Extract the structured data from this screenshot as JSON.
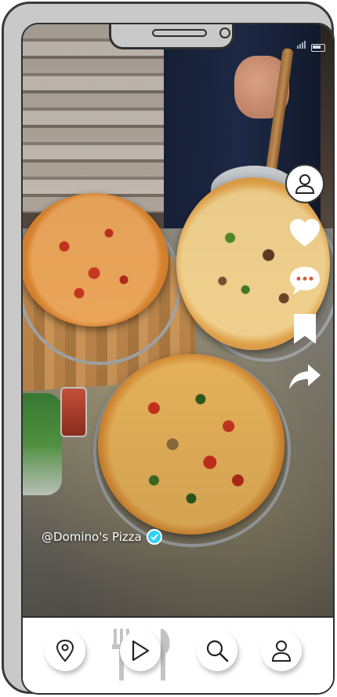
{
  "post": {
    "handle": "@Domino's Pizza",
    "verified": true
  },
  "actions": [
    {
      "name": "profile",
      "icon": "user-icon"
    },
    {
      "name": "like",
      "icon": "heart-icon"
    },
    {
      "name": "comment",
      "icon": "chat-bubble-icon"
    },
    {
      "name": "save",
      "icon": "bookmark-icon"
    },
    {
      "name": "share",
      "icon": "share-arrow-icon"
    }
  ],
  "bottom_nav": [
    {
      "name": "location",
      "icon": "map-pin-icon"
    },
    {
      "name": "play",
      "icon": "play-icon",
      "active": true
    },
    {
      "name": "search",
      "icon": "search-icon"
    },
    {
      "name": "profile",
      "icon": "user-icon"
    }
  ],
  "colors": {
    "verified_badge": "#2fd1f3",
    "frame": "#c9c9c9",
    "outline": "#2f2f2f"
  }
}
